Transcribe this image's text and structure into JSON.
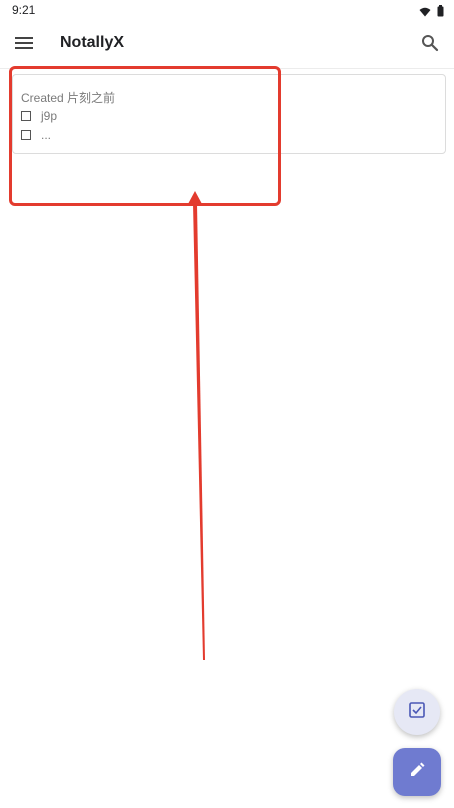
{
  "status_bar": {
    "time": "9:21",
    "icons": [
      "wifi-icon",
      "battery-icon"
    ]
  },
  "toolbar": {
    "title": "NotallyX",
    "menu_icon": "hamburger-menu-icon",
    "search_icon": "search-icon"
  },
  "note": {
    "date": "Created 片刻之前",
    "items": [
      {
        "text": "j9p",
        "checked": false
      },
      {
        "text": "...",
        "checked": false
      }
    ]
  },
  "fab": {
    "new_list_icon": "checkbox-icon",
    "new_note_icon": "pencil-icon"
  },
  "annotation": {
    "color": "#e33b2e"
  },
  "colors": {
    "fab_primary": "#6f7bd0",
    "fab_secondary": "#e6e8f5"
  }
}
